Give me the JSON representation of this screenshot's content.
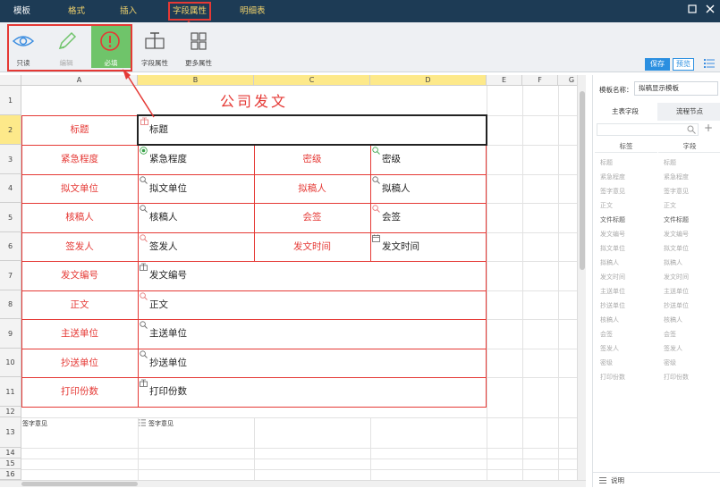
{
  "topbar": {
    "tabs": [
      "模板",
      "格式",
      "插入",
      "字段属性",
      "明细表"
    ],
    "active_tab": "字段属性"
  },
  "toolbar": {
    "readonly": "只读",
    "edit": "编辑",
    "required": "必填",
    "field_props": "字段属性",
    "more_props": "更多属性",
    "save": "保存",
    "preview": "预览"
  },
  "sheet": {
    "columns": [
      "A",
      "B",
      "C",
      "D",
      "E",
      "F",
      "G"
    ],
    "rows": [
      "1",
      "2",
      "3",
      "4",
      "5",
      "6",
      "7",
      "8",
      "9",
      "10",
      "11",
      "12",
      "13",
      "14",
      "15",
      "16"
    ],
    "title": "公司发文",
    "labels": {
      "r2a": "标题",
      "r2b": "标题",
      "r3a": "紧急程度",
      "r3b": "紧急程度",
      "r3c": "密级",
      "r3d": "密级",
      "r4a": "拟文单位",
      "r4b": "拟文单位",
      "r4c": "拟稿人",
      "r4d": "拟稿人",
      "r5a": "核稿人",
      "r5b": "核稿人",
      "r5c": "会签",
      "r5d": "会签",
      "r6a": "签发人",
      "r6b": "签发人",
      "r6c": "发文时间",
      "r6d": "发文时间",
      "r7a": "发文编号",
      "r7b": "发文编号",
      "r8a": "正文",
      "r8b": "正文",
      "r9a": "主送单位",
      "r9b": "主送单位",
      "r10a": "抄送单位",
      "r10b": "抄送单位",
      "r11a": "打印份数",
      "r11b": "打印份数",
      "r13a": "签字意见",
      "r13b": "签字意见"
    }
  },
  "panel": {
    "template_label": "模板名称：",
    "template_name": "拟稿显示模板",
    "tab_main": "主表字段",
    "tab_flow": "流程节点",
    "col_label": "标签",
    "col_field": "字段",
    "items": [
      "标题",
      "紧急程度",
      "签字意见",
      "正文",
      "文件标题",
      "发文编号",
      "拟文单位",
      "拟稿人",
      "发文时间",
      "主送单位",
      "抄送单位",
      "核稿人",
      "会签",
      "签发人",
      "密级",
      "打印份数"
    ],
    "footer": "说明"
  }
}
